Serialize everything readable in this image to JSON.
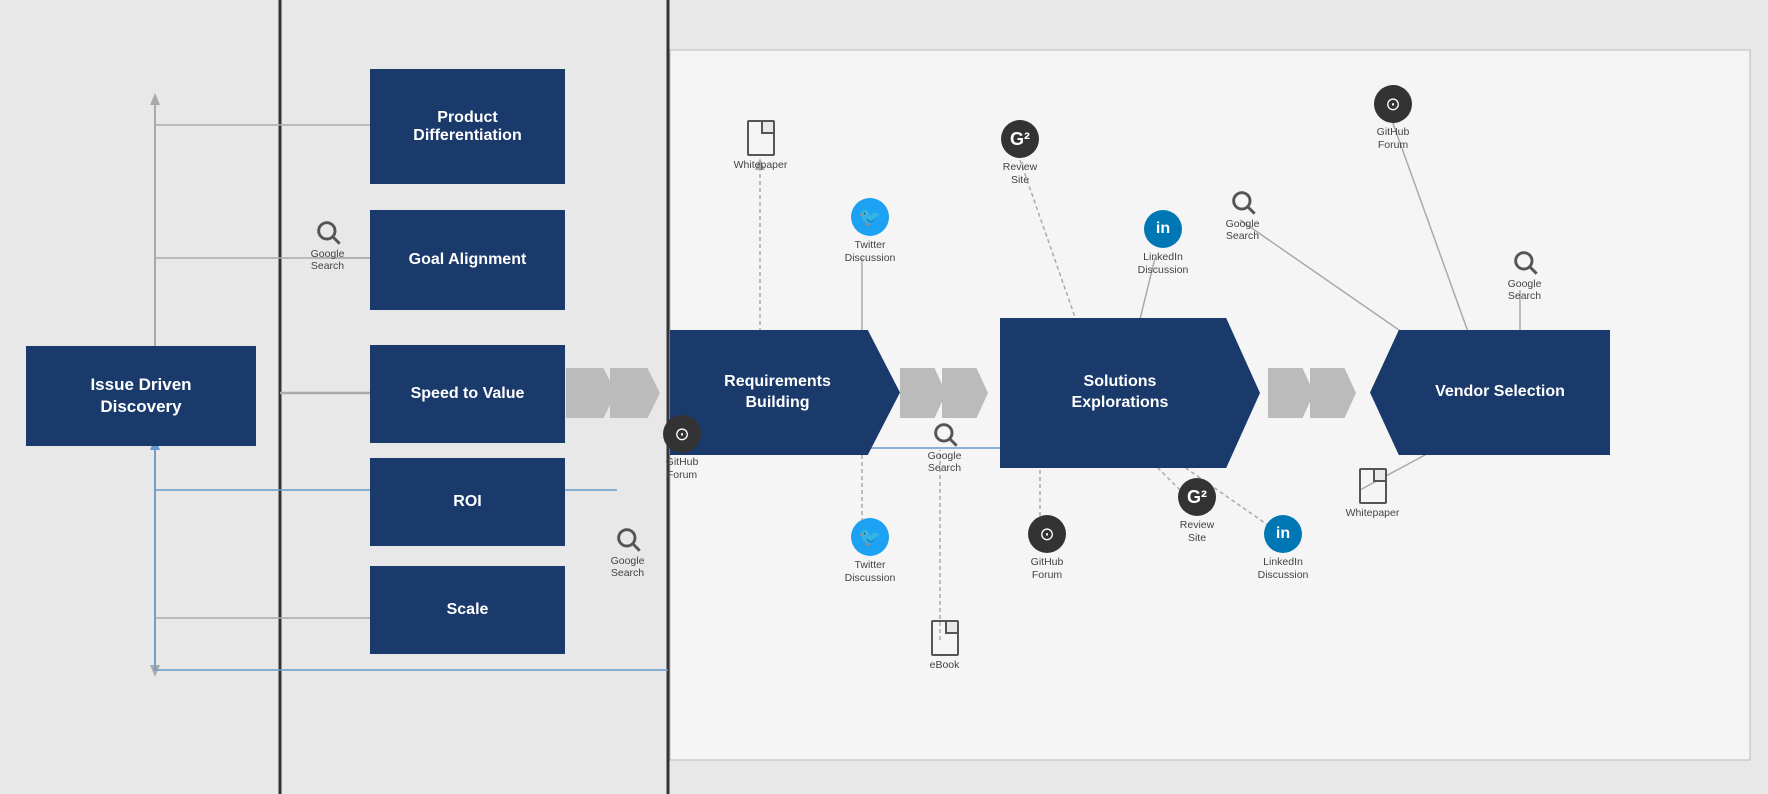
{
  "stages": {
    "issue_driven": {
      "label": "Issue Driven\nDiscovery"
    },
    "requirements": {
      "label": "Requirements\nBuilding"
    },
    "solutions": {
      "label": "Solutions\nExplorations"
    },
    "vendor": {
      "label": "Vendor Selection"
    }
  },
  "categories": {
    "product_diff": {
      "label": "Product\nDifferentiation"
    },
    "goal_alignment": {
      "label": "Goal Alignment"
    },
    "speed_to_value": {
      "label": "Speed to Value"
    },
    "roi": {
      "label": "ROI"
    },
    "scale": {
      "label": "Scale"
    }
  },
  "nodes": {
    "whitepaper1": {
      "label": "Whitepaper"
    },
    "whitepaper2": {
      "label": "Whitepaper"
    },
    "review_site1": {
      "label": "Review\nSite"
    },
    "review_site2": {
      "label": "Review\nSite"
    },
    "twitter1": {
      "label": "Twitter\nDiscussion"
    },
    "twitter2": {
      "label": "Twitter\nDiscussion"
    },
    "github_forum1": {
      "label": "GitHub\nForum"
    },
    "github_forum2": {
      "label": "GitHub\nForum"
    },
    "github_forum3": {
      "label": "GitHub\nForum"
    },
    "linkedin1": {
      "label": "LinkedIn\nDiscussion"
    },
    "linkedin2": {
      "label": "LinkedIn\nDiscussion"
    },
    "google_search1": {
      "label": "Google\nSearch"
    },
    "google_search2": {
      "label": "Google\nSearch"
    },
    "google_search3": {
      "label": "Google\nSearch"
    },
    "google_search4": {
      "label": "Google\nSearch"
    },
    "google_search5": {
      "label": "Google\nSearch"
    },
    "ebook": {
      "label": "eBook"
    }
  }
}
